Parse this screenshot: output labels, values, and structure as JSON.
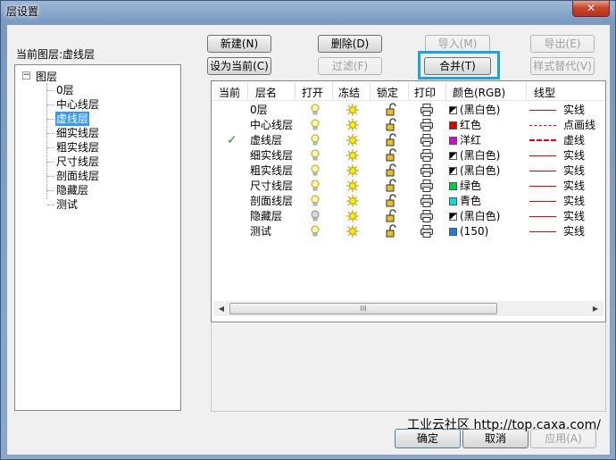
{
  "window": {
    "title": "层设置",
    "close_glyph": "✕"
  },
  "current_layer_text": "当前图层:虚线层",
  "tree": {
    "toggle": "−",
    "root_label": "图层",
    "items": [
      "0层",
      "中心线层",
      "虚线层",
      "细实线层",
      "粗实线层",
      "尺寸线层",
      "剖面线层",
      "隐藏层",
      "测试"
    ],
    "selected": "虚线层"
  },
  "buttons": {
    "new": "新建(N)",
    "delete": "删除(D)",
    "import": "导入(M)",
    "export": "导出(E)",
    "set_current": "设为当前(C)",
    "filter": "过滤(F)",
    "merge": "合并(T)",
    "style_replace": "样式替代(V)",
    "ok": "确定",
    "cancel": "取消",
    "apply": "应用(A)"
  },
  "table": {
    "headers": [
      "当前",
      "层名",
      "打开",
      "冻结",
      "锁定",
      "打印",
      "颜色(RGB)",
      "线型"
    ],
    "rows": [
      {
        "current": "",
        "name": "0层",
        "color_text": "(黑白色)",
        "color_hex": "#000000",
        "bw": true,
        "linetype": "实线",
        "lt_style": "solid",
        "bulb_on": true
      },
      {
        "current": "",
        "name": "中心线层",
        "color_text": "红色",
        "color_hex": "#e00000",
        "bw": false,
        "linetype": "点画线",
        "lt_style": "dashdot",
        "bulb_on": true
      },
      {
        "current": "✓",
        "name": "虚线层",
        "color_text": "洋红",
        "color_hex": "#e000e0",
        "bw": false,
        "linetype": "虚线",
        "lt_style": "dash",
        "bulb_on": true
      },
      {
        "current": "",
        "name": "细实线层",
        "color_text": "(黑白色)",
        "color_hex": "#000000",
        "bw": true,
        "linetype": "实线",
        "lt_style": "solid",
        "bulb_on": true
      },
      {
        "current": "",
        "name": "粗实线层",
        "color_text": "(黑白色)",
        "color_hex": "#000000",
        "bw": true,
        "linetype": "实线",
        "lt_style": "solid",
        "bulb_on": true
      },
      {
        "current": "",
        "name": "尺寸线层",
        "color_text": "绿色",
        "color_hex": "#00d040",
        "bw": false,
        "linetype": "实线",
        "lt_style": "solid",
        "bulb_on": true
      },
      {
        "current": "",
        "name": "剖面线层",
        "color_text": "青色",
        "color_hex": "#00e0e0",
        "bw": false,
        "linetype": "实线",
        "lt_style": "solid",
        "bulb_on": true
      },
      {
        "current": "",
        "name": "隐藏层",
        "color_text": "(黑白色)",
        "color_hex": "#000000",
        "bw": true,
        "linetype": "实线",
        "lt_style": "solid",
        "bulb_on": false
      },
      {
        "current": "",
        "name": "测试",
        "color_text": "(150)",
        "color_hex": "#1e78e6",
        "bw": false,
        "linetype": "实线",
        "lt_style": "solid",
        "bulb_on": true
      }
    ]
  },
  "scrollbar": {
    "left_glyph": "◀",
    "right_glyph": "▶",
    "grip": "III"
  },
  "watermark": "工业云社区 http://top.caxa.com/"
}
